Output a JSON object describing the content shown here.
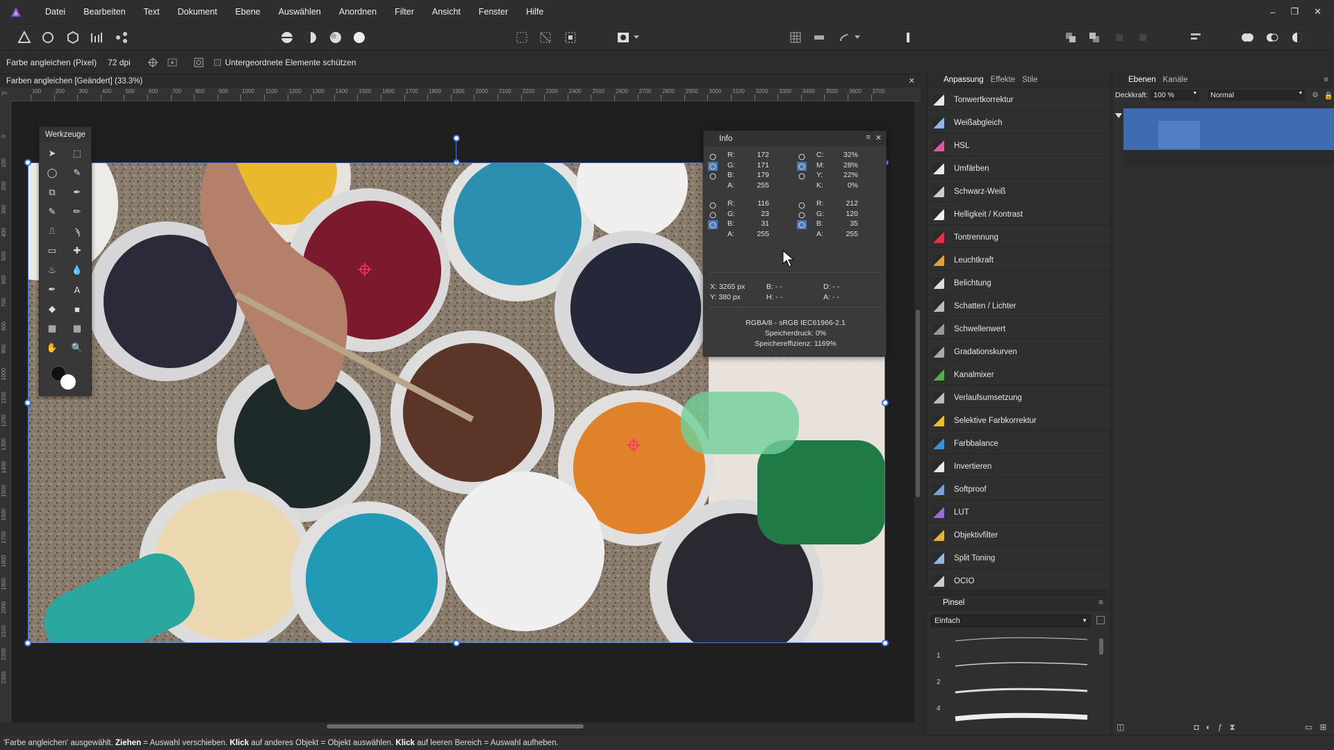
{
  "menu": {
    "items": [
      "Datei",
      "Bearbeiten",
      "Text",
      "Dokument",
      "Ebene",
      "Auswählen",
      "Anordnen",
      "Filter",
      "Ansicht",
      "Fenster",
      "Hilfe"
    ]
  },
  "window_controls": {
    "minimize": "–",
    "restore": "❐",
    "close": "✕"
  },
  "context": {
    "tool_name": "Farbe angleichen (Pixel)",
    "dpi": "72 dpi",
    "protect_label": "Untergeordnete Elemente schützen"
  },
  "document": {
    "title": "Farben angleichen [Geändert] (33.3%)",
    "close": "✕"
  },
  "ruler": {
    "unit": "px",
    "h_ticks": [
      "100",
      "200",
      "300",
      "400",
      "500",
      "600",
      "700",
      "800",
      "900",
      "1000",
      "1100",
      "1200",
      "1300",
      "1400",
      "1500",
      "1600",
      "1700",
      "1800",
      "1900",
      "2000",
      "2100",
      "2200",
      "2300",
      "2400",
      "2500",
      "2600",
      "2700",
      "2800",
      "2900",
      "3000",
      "3100",
      "3200",
      "3300",
      "3400",
      "3500",
      "3600",
      "3700"
    ],
    "v_ticks": [
      "0",
      "100",
      "200",
      "300",
      "400",
      "500",
      "600",
      "700",
      "800",
      "900",
      "1000",
      "1100",
      "1200",
      "1300",
      "1400",
      "1500",
      "1600",
      "1700",
      "1800",
      "1900",
      "2000",
      "2100",
      "2200",
      "2300"
    ]
  },
  "tools_panel": {
    "title": "Werkzeuge",
    "tools": [
      "move-tool",
      "marquee-tool",
      "lasso-tool",
      "brush-selection-tool",
      "crop-tool",
      "eyedropper-tool",
      "color-replace-tool",
      "paint-brush-tool",
      "clone-stamp-tool",
      "smudge-tool",
      "eraser-tool",
      "healing-tool",
      "burn-tool",
      "blur-tool",
      "pen-tool",
      "text-tool",
      "fill-tool",
      "shape-tool",
      "mesh-tool",
      "grid-tool",
      "hand-tool",
      "zoom-tool"
    ]
  },
  "info_panel": {
    "title": "Info",
    "block1_left": [
      [
        "R:",
        "172"
      ],
      [
        "G:",
        "171"
      ],
      [
        "B:",
        "179"
      ],
      [
        "A:",
        "255"
      ]
    ],
    "block1_right": [
      [
        "C:",
        "32%"
      ],
      [
        "M:",
        "28%"
      ],
      [
        "Y:",
        "22%"
      ],
      [
        "K:",
        "0%"
      ]
    ],
    "block2_left": [
      [
        "R:",
        "116"
      ],
      [
        "G:",
        "23"
      ],
      [
        "B:",
        "31"
      ],
      [
        "A:",
        "255"
      ]
    ],
    "block2_right": [
      [
        "R:",
        "212"
      ],
      [
        "G:",
        "120"
      ],
      [
        "B:",
        "35"
      ],
      [
        "A:",
        "255"
      ]
    ],
    "coords": {
      "x": "X: 3265 px",
      "y": "Y: 380 px",
      "b": "B: - -",
      "h": "H: - -",
      "d": "D: - -",
      "a": "A: - -"
    },
    "footer": [
      "RGBA/8 - sRGB IEC61966-2.1",
      "Speicherdruck: 0%",
      "Speichereffizienz: 1169%"
    ]
  },
  "adjustments": {
    "tabs": [
      "Anpassung",
      "Effekte",
      "Stile"
    ],
    "items": [
      {
        "label": "Tonwertkorrektur",
        "color": "#e8e8e8"
      },
      {
        "label": "Weißabgleich",
        "color": "#8fb4e8"
      },
      {
        "label": "HSL",
        "color": "#d65aa0"
      },
      {
        "label": "Umfärben",
        "color": "#e8e8e8"
      },
      {
        "label": "Schwarz-Weiß",
        "color": "#cccccc"
      },
      {
        "label": "Helligkeit / Kontrast",
        "color": "#f0f0f0"
      },
      {
        "label": "Tontrennung",
        "color": "#e0304a"
      },
      {
        "label": "Leuchtkraft",
        "color": "#e8a030"
      },
      {
        "label": "Belichtung",
        "color": "#dddddd"
      },
      {
        "label": "Schatten / Lichter",
        "color": "#bbbbbb"
      },
      {
        "label": "Schwellenwert",
        "color": "#999999"
      },
      {
        "label": "Gradationskurven",
        "color": "#aaaaaa"
      },
      {
        "label": "Kanalmixer",
        "color": "#4caf50"
      },
      {
        "label": "Verlaufsumsetzung",
        "color": "#bbbbbb"
      },
      {
        "label": "Selektive Farbkorrektur",
        "color": "#e8c020"
      },
      {
        "label": "Farbbalance",
        "color": "#3a8fd8"
      },
      {
        "label": "Invertieren",
        "color": "#e8e8e8"
      },
      {
        "label": "Softproof",
        "color": "#7aa0d0"
      },
      {
        "label": "LUT",
        "color": "#9a6cd8"
      },
      {
        "label": "Objektivfilter",
        "color": "#e8b040"
      },
      {
        "label": "Split Toning",
        "color": "#90b8e0"
      },
      {
        "label": "OCIO",
        "color": "#cccccc"
      }
    ]
  },
  "brushes": {
    "title": "Pinsel",
    "category": "Einfach",
    "sizes": [
      "1",
      "2",
      "4"
    ]
  },
  "layers": {
    "tabs": [
      "Ebenen",
      "Kanäle"
    ],
    "opacity_label": "Deckkraft:",
    "opacity_value": "100 %",
    "blend_mode": "Normal"
  },
  "status": {
    "part1": "'Farbe angleichen' ausgewählt. ",
    "b1": "Ziehen",
    "part2": " = Auswahl verschieben. ",
    "b2": "Klick",
    "part3": " auf anderes Objekt = Objekt auswählen. ",
    "b3": "Klick",
    "part4": " auf leeren Bereich = Auswahl aufheben."
  },
  "colors": {
    "accent": "#4a77b8",
    "selection": "#3d6fd9",
    "app_logo": "#8a4fd8"
  }
}
